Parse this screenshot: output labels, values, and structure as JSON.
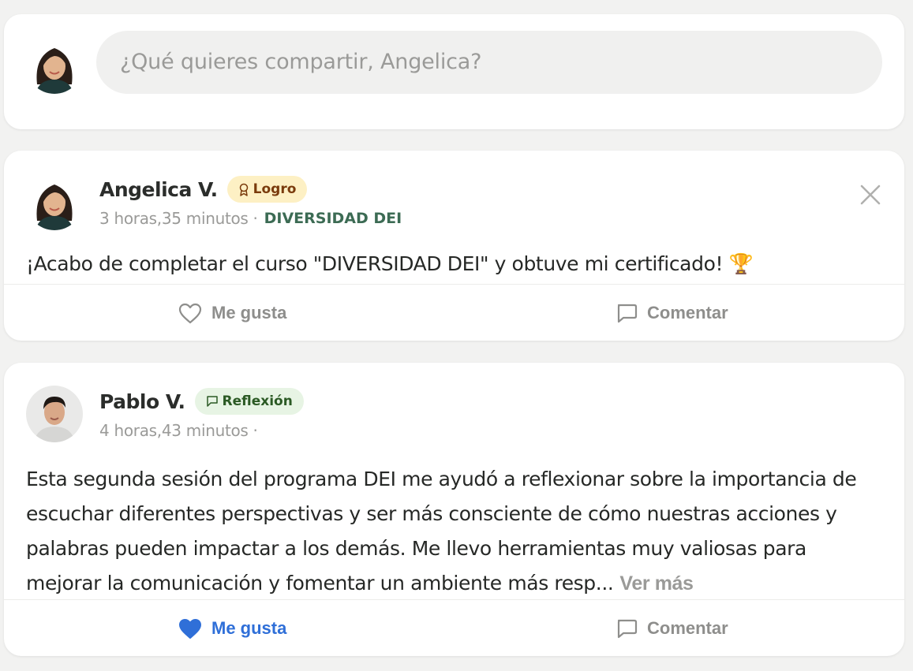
{
  "composer": {
    "placeholder": "¿Qué quieres compartir, Angelica?"
  },
  "posts": [
    {
      "author": "Angelica V.",
      "badge": "Logro",
      "time": "3 horas,35 minutos",
      "separator": "·",
      "tag": "DIVERSIDAD DEI",
      "body": "¡Acabo de completar el curso \"DIVERSIDAD DEI\" y obtuve mi certificado! 🏆",
      "like_label": "Me gusta",
      "comment_label": "Comentar",
      "liked": false
    },
    {
      "author": "Pablo V.",
      "badge": "Reflexión",
      "time": "4 horas,43 minutos",
      "separator": "·",
      "tag": "",
      "body": "Esta segunda sesión del programa DEI me ayudó a reflexionar sobre la importancia de escuchar diferentes perspectivas y ser más consciente de cómo nuestras acciones y palabras pueden impactar a los demás. Me llevo herramientas muy valiosas para mejorar la comunicación y fomentar un ambiente más resp...",
      "see_more": "Ver más",
      "like_label": "Me gusta",
      "comment_label": "Comentar",
      "liked": true
    }
  ],
  "colors": {
    "background": "#f2f2f1",
    "liked": "#2f6fd8",
    "tag": "#3c6b54",
    "badge_logro_bg": "#fdf0c4",
    "badge_reflexion_bg": "#e7f4e4"
  },
  "icons": [
    "avatar",
    "award-icon",
    "chat-icon",
    "close-icon",
    "heart-icon",
    "heart-filled-icon",
    "comment-icon"
  ]
}
